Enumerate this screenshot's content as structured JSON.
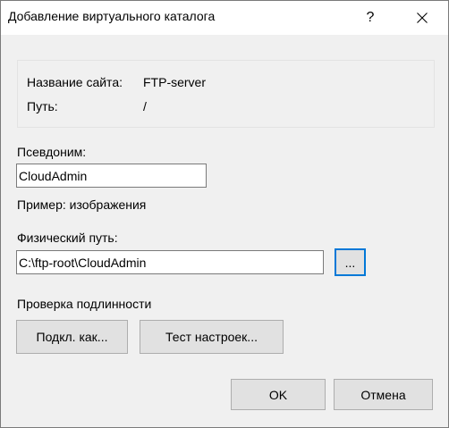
{
  "window": {
    "title": "Добавление виртуального каталога",
    "help_glyph": "?",
    "close_glyph": "✕"
  },
  "site_info": {
    "site_name_label": "Название сайта:",
    "site_name_value": "FTP-server",
    "path_label": "Путь:",
    "path_value": "/"
  },
  "alias": {
    "label": "Псевдоним:",
    "value": "CloudAdmin",
    "example": "Пример: изображения"
  },
  "physical_path": {
    "label": "Физический путь:",
    "value": "C:\\ftp-root\\CloudAdmin",
    "browse_label": "..."
  },
  "auth": {
    "heading": "Проверка подлинности",
    "connect_as_label": "Подкл. как...",
    "test_settings_label": "Тест настроек..."
  },
  "footer": {
    "ok_label": "OK",
    "cancel_label": "Отмена"
  },
  "colors": {
    "dialog_bg": "#f0f0f0",
    "titlebar_bg": "#ffffff",
    "button_bg": "#e1e1e1",
    "button_border": "#adadad",
    "focus_border": "#0078d7"
  }
}
